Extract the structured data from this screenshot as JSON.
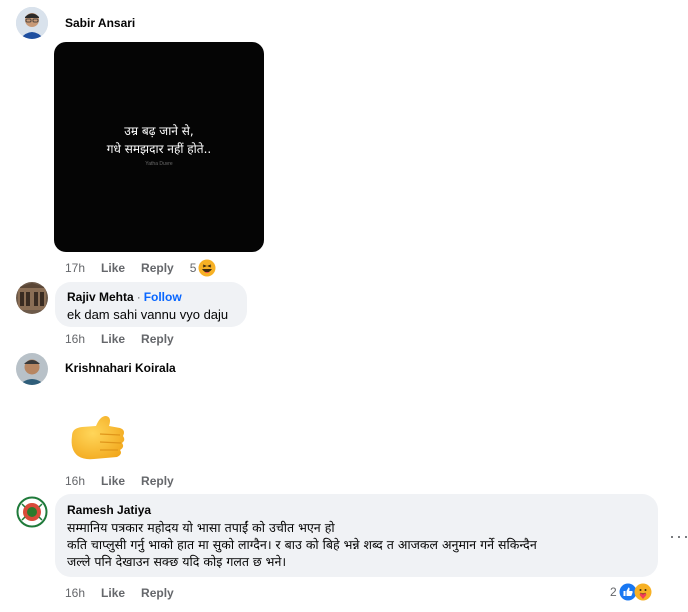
{
  "comments": [
    {
      "author": "Sabir Ansari",
      "image_text": [
        "उम्र बढ़ जाने से,",
        "गधे समझदार नहीं होते.."
      ],
      "image_credit": "Yatha Duvre",
      "time": "17h",
      "like": "Like",
      "reply": "Reply",
      "reaction_count": "5"
    },
    {
      "author": "Rajiv Mehta",
      "follow": "Follow",
      "separator": "·",
      "text": "ek dam sahi vannu vyo daju",
      "time": "16h",
      "like": "Like",
      "reply": "Reply"
    },
    {
      "author": "Krishnahari Koirala",
      "time": "16h",
      "like": "Like",
      "reply": "Reply"
    },
    {
      "author": "Ramesh Jatiya",
      "text_lines": [
        "सम्मानिय पत्रकार महोदय यो भासा तपाईं को उचीत भएन हो",
        "कति चाप्लुसी गर्नु भाको हात मा सुको लाग्दैन। र बाउ को बिहे भन्ने शब्द त आजकल अनुमान गर्ने सकिन्दैन",
        "जल्ले पनि देखाउन सक्छ यदि कोइ गलत छ भने।"
      ],
      "time": "16h",
      "like": "Like",
      "reply": "Reply",
      "reaction_count": "2",
      "more": "···"
    }
  ],
  "colors": {
    "link": "#0866ff",
    "bubble": "#f0f2f5",
    "meta": "#65676b"
  }
}
